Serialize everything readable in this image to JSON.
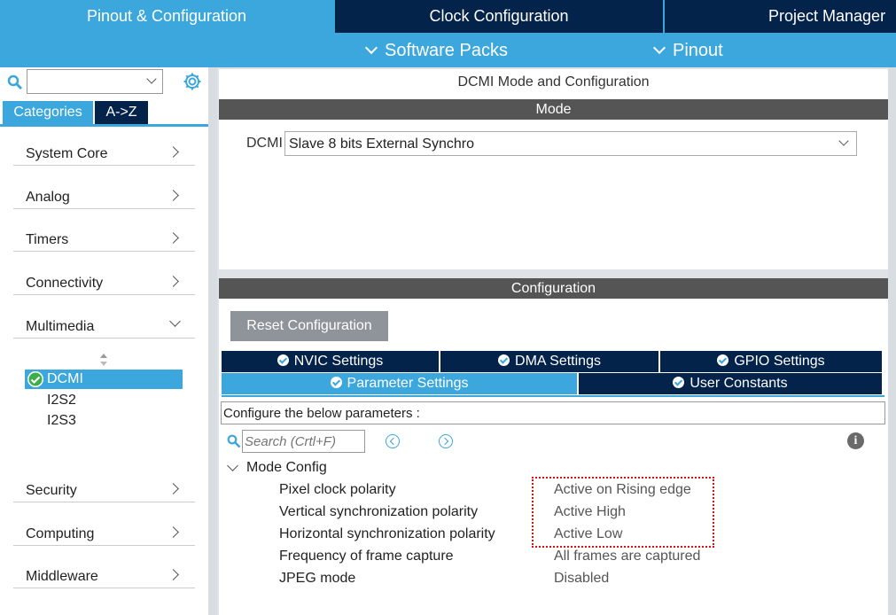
{
  "top_tabs": [
    {
      "label": "Pinout & Configuration"
    },
    {
      "label": "Clock Configuration"
    },
    {
      "label": "Project Manager"
    }
  ],
  "sub_tabs": [
    {
      "label": "Software Packs"
    },
    {
      "label": "Pinout"
    }
  ],
  "sidebar": {
    "search_value": "",
    "view_tabs": [
      {
        "label": "Categories",
        "selected": true
      },
      {
        "label": "A->Z",
        "selected": false
      }
    ],
    "categories": [
      {
        "label": "System Core"
      },
      {
        "label": "Analog"
      },
      {
        "label": "Timers"
      },
      {
        "label": "Connectivity"
      },
      {
        "label": "Multimedia",
        "expanded": true
      },
      {
        "label": "Security"
      },
      {
        "label": "Computing"
      },
      {
        "label": "Middleware"
      }
    ],
    "multimedia_items": [
      {
        "label": "DCMI",
        "selected": true,
        "enabled": true
      },
      {
        "label": "I2S2"
      },
      {
        "label": "I2S3"
      }
    ]
  },
  "mode_panel": {
    "title": "DCMI Mode and Configuration",
    "mode_header": "Mode",
    "dcmi_label": "DCMI",
    "dcmi_value": "Slave 8 bits External Synchro"
  },
  "config_panel": {
    "header": "Configuration",
    "reset_label": "Reset Configuration",
    "tabs_row1": [
      {
        "label": "NVIC Settings"
      },
      {
        "label": "DMA Settings"
      },
      {
        "label": "GPIO Settings"
      }
    ],
    "tabs_row2": [
      {
        "label": "Parameter Settings",
        "selected": true
      },
      {
        "label": "User Constants"
      }
    ],
    "description": "Configure the below parameters :",
    "search_placeholder": "Search (Crtl+F)",
    "group_label": "Mode Config",
    "params": [
      {
        "name": "Pixel clock polarity",
        "value": "Active on Rising edge"
      },
      {
        "name": "Vertical synchronization polarity",
        "value": "Active High"
      },
      {
        "name": "Horizontal synchronization polarity",
        "value": "Active Low"
      },
      {
        "name": "Frequency of frame capture",
        "value": "All frames are captured"
      },
      {
        "name": "JPEG mode",
        "value": "Disabled"
      }
    ]
  },
  "colors": {
    "accent": "#3ba7dc",
    "dark_tab": "#04234a",
    "section_bar": "#555555",
    "highlight": "#dd1111"
  }
}
